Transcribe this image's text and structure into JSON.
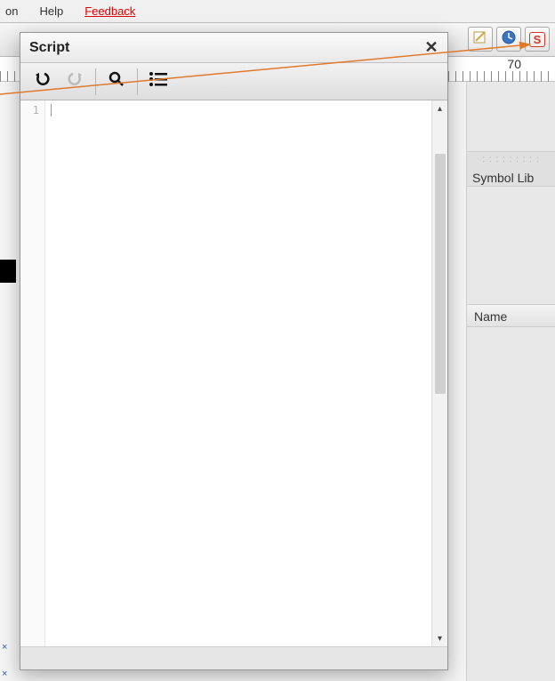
{
  "menu": {
    "partial_item": "on",
    "help_label": "Help",
    "feedback_label": "Feedback"
  },
  "toolbar_icons": {
    "edit_glyph": "📝",
    "clock_glyph": "◔",
    "script_glyph": "S"
  },
  "ruler": {
    "mark_70": "70"
  },
  "right_panel": {
    "library_title": "Symbol Lib",
    "name_column": "Name"
  },
  "dialog": {
    "title": "Script",
    "line_number": "1"
  },
  "colors": {
    "arrow": "#e07a2a",
    "feedback_link": "#d00000",
    "script_icon_border": "#d43a2a"
  }
}
